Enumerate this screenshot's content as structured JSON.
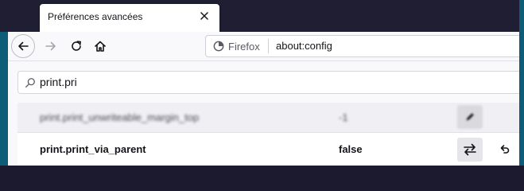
{
  "tab": {
    "title": "Préférences avancées"
  },
  "toolbar": {
    "identity_label": "Firefox",
    "url": "about:config"
  },
  "search": {
    "value": "print.pri"
  },
  "prefs": [
    {
      "name": "print.print_unwriteable_margin_top",
      "value": "-1",
      "action": "edit-icon"
    },
    {
      "name": "print.print_via_parent",
      "value": "false",
      "action": "toggle-icon",
      "secondary_action": "reset-icon"
    }
  ],
  "colors": {
    "titlebar": "#1f1e33",
    "window_border": "#0e5d78",
    "toolbar": "#f9f9fb"
  }
}
